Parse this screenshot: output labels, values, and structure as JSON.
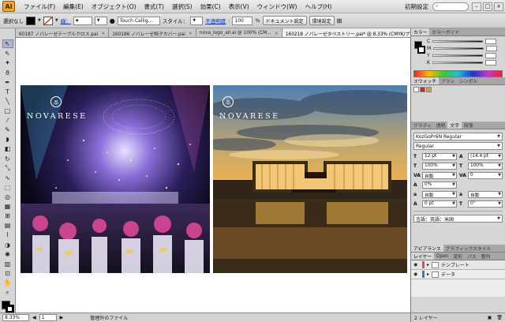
{
  "app": {
    "logo": "Ai",
    "workspace": "初期設定"
  },
  "menu": [
    "ファイル(F)",
    "編集(E)",
    "オブジェクト(O)",
    "書式(T)",
    "選択(S)",
    "効果(C)",
    "表示(V)",
    "ウィンドウ(W)",
    "ヘルプ(H)"
  ],
  "control": {
    "selection": "選択なし",
    "stroke_label": "線：",
    "brush": "Touch Callig...",
    "style_label": "スタイル：",
    "opacity_label": "不透明度",
    "opacity_value": "100",
    "percent": "%",
    "doc_setup": "ドキュメント設定",
    "prefs": "環境設定"
  },
  "tabs": [
    {
      "label": "60187 ノバレーゼテーブルクロス.pai"
    },
    {
      "label": "160186 ノバレーゼ椅子カバー.pai"
    },
    {
      "label": "nova_logo_all.ai @ 100% (CM..."
    },
    {
      "label": "160218 ノバレーゼタペストリー.pai* @ 8.33% (CMYK/プレビュー)"
    }
  ],
  "artwork": {
    "brand": "NOVARESE"
  },
  "status": {
    "zoom": "8.33%",
    "page": "1",
    "file_mgmt": "管理外のファイル"
  },
  "panels": {
    "color_tabs": [
      "カラー",
      "カラーガイド"
    ],
    "channels": [
      "C",
      "M",
      "Y",
      "K"
    ],
    "swatch_tabs": [
      "スウォッチ",
      "ブラシ",
      "シンボル"
    ],
    "type_tabs": [
      "グラディ",
      "透明",
      "文字",
      "段落"
    ],
    "font": "KozGoPr6N Regular",
    "font_style": "Regular",
    "char_fields": [
      {
        "icon": "T",
        "value": "12 pt"
      },
      {
        "icon": "A",
        "value": "(14.4 pt"
      },
      {
        "icon": "T",
        "value": "100%"
      },
      {
        "icon": "T",
        "value": "100%"
      },
      {
        "icon": "VA",
        "value": "自動"
      },
      {
        "icon": "VA",
        "value": "0"
      },
      {
        "icon": "A",
        "value": "0%"
      },
      {
        "icon": "",
        "value": ""
      },
      {
        "icon": "a",
        "value": "自動"
      },
      {
        "icon": "a",
        "value": "自動"
      },
      {
        "icon": "A",
        "value": "0 pt"
      },
      {
        "icon": "T",
        "value": "0°"
      }
    ],
    "language": "言語：英語：米国",
    "appearance_tabs": [
      "アピアランス",
      "グラフィックスタイル"
    ],
    "layer_tabs": [
      "レイヤー",
      "Open",
      "変形",
      "パス",
      "整列"
    ],
    "layers": [
      {
        "name": "テンプレート",
        "color": "#e04a4a"
      },
      {
        "name": "データ",
        "color": "#4a6ae0"
      }
    ],
    "layer_count": "2 レイヤー"
  }
}
